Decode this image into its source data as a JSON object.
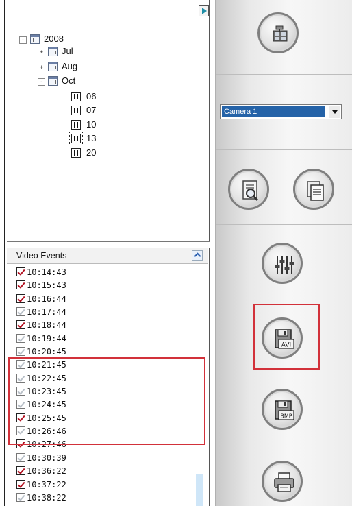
{
  "tree": {
    "year": "2008",
    "months": [
      {
        "label": "Jul",
        "expander": "+"
      },
      {
        "label": "Aug",
        "expander": "+"
      },
      {
        "label": "Oct",
        "expander": "-"
      }
    ],
    "days": [
      "06",
      "07",
      "10",
      "13",
      "20"
    ],
    "year_expander": "-"
  },
  "events": {
    "title": "Video Events",
    "items": [
      {
        "time": "10:14:43",
        "checked": "strong"
      },
      {
        "time": "10:15:43",
        "checked": "strong"
      },
      {
        "time": "10:16:44",
        "checked": "strong"
      },
      {
        "time": "10:17:44",
        "checked": "light"
      },
      {
        "time": "10:18:44",
        "checked": "strong"
      },
      {
        "time": "10:19:44",
        "checked": "light"
      },
      {
        "time": "10:20:45",
        "checked": "light"
      },
      {
        "time": "10:21:45",
        "checked": "light"
      },
      {
        "time": "10:22:45",
        "checked": "light"
      },
      {
        "time": "10:23:45",
        "checked": "light"
      },
      {
        "time": "10:24:45",
        "checked": "light"
      },
      {
        "time": "10:25:45",
        "checked": "strong"
      },
      {
        "time": "10:26:46",
        "checked": "light"
      },
      {
        "time": "10:27:46",
        "checked": "strong"
      },
      {
        "time": "10:30:39",
        "checked": "light"
      },
      {
        "time": "10:36:22",
        "checked": "strong"
      },
      {
        "time": "10:37:22",
        "checked": "strong"
      },
      {
        "time": "10:38:22",
        "checked": "light"
      }
    ]
  },
  "camera": {
    "selected": "Camera 1"
  },
  "buttons": {
    "avi_label": "AVI",
    "bmp_label": "BMP"
  },
  "icons": {
    "expand": "expand-right-icon",
    "collapse": "collapse-up-icon",
    "layout": "layout-tools-icon",
    "search": "search-document-icon",
    "windows": "windows-copy-icon",
    "settings": "sliders-icon",
    "save_avi": "save-avi-icon",
    "save_bmp": "save-bmp-icon",
    "print": "printer-icon"
  },
  "colors": {
    "highlight": "#d2313a",
    "selection": "#2563a8",
    "check_strong": "#b21020"
  }
}
